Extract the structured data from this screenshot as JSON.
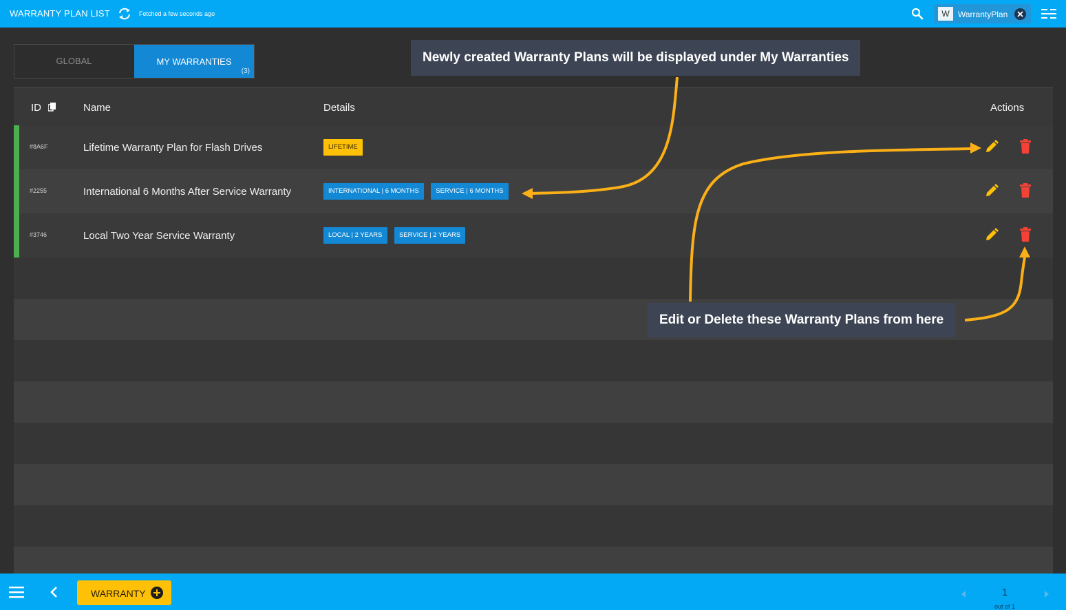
{
  "topbar": {
    "title": "WARRANTY PLAN LIST",
    "fetched": "Fetched a few seconds ago",
    "chip_avatar": "W",
    "chip_label": "WarrantyPlan"
  },
  "tabs": {
    "global": "GLOBAL",
    "mine": "MY WARRANTIES",
    "mine_count": "(3)"
  },
  "table": {
    "headers": {
      "id": "ID",
      "name": "Name",
      "details": "Details",
      "actions": "Actions"
    },
    "rows": [
      {
        "id": "#8A6F",
        "name": "Lifetime Warranty Plan for Flash Drives",
        "tags": [
          "LIFETIME"
        ]
      },
      {
        "id": "#2255",
        "name": "International 6 Months After Service Warranty",
        "tags": [
          "INTERNATIONAL | 6 MONTHS",
          "SERVICE | 6 MONTHS"
        ]
      },
      {
        "id": "#3746",
        "name": "Local Two Year Service Warranty",
        "tags": [
          "LOCAL | 2 YEARS",
          "SERVICE | 2 YEARS"
        ]
      }
    ]
  },
  "callouts": {
    "top": "Newly created Warranty Plans will be displayed under My Warranties",
    "bottom": "Edit or Delete these Warranty Plans from here"
  },
  "bottombar": {
    "warranty_label": "WARRANTY",
    "page": "1",
    "page_out_of": "out of 1"
  },
  "colors": {
    "topbar": "#03a9f4",
    "tab_active": "#1388d4",
    "tag_yellow": "#ffc107",
    "row_accent": "#4caf50",
    "edit_icon": "#ffc107",
    "delete_icon": "#f44336",
    "callout_arrow": "#fbb017"
  }
}
